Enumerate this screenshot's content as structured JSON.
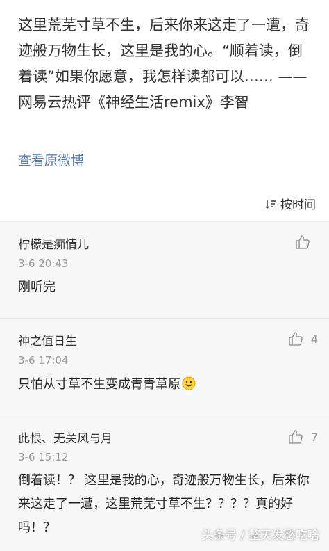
{
  "post": {
    "text": "这里荒芜寸草不生，后来你来这走了一遭，奇迹般万物生长，这里是我的心。“顺着读，倒着读”如果你愿意，我怎样读都可以…… ——网易云热评《神经生活remix》李智",
    "view_original": "查看原微博",
    "sort_label": "按时间"
  },
  "comments": [
    {
      "name": "柠檬是痴情儿",
      "time": "3-6 20:43",
      "body": "刚听完",
      "likes": ""
    },
    {
      "name": "神之值日生",
      "time": "3-6 17:04",
      "body": "只怕从寸草不生变成青青草原",
      "likes": "4"
    },
    {
      "name": "此恨、无关风与月",
      "time": "3-6 15:12",
      "body": "倒着读！？ 这里是我的心，奇迹般万物生长，后来你来这走了一遭，这里荒芜寸草不生？？？？真的好吗！？",
      "likes": "7"
    }
  ],
  "watermark": "头条号 / 整天发愁吃啥",
  "colors": {
    "link": "#5b7cb1",
    "meta": "#999999"
  }
}
